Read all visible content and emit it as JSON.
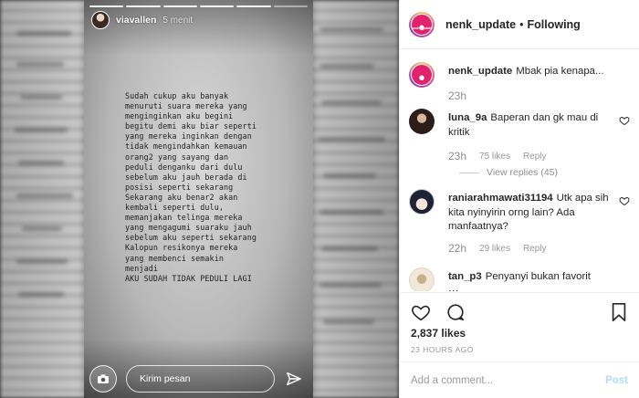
{
  "story": {
    "username": "viavallen",
    "time": "5 menit",
    "text_lines": [
      "Sudah cukup aku banyak",
      "menuruti suara mereka yang",
      "menginginkan aku begini",
      "begitu demi aku biar seperti",
      "yang mereka inginkan dengan",
      "tidak mengindahkan kemauan",
      "orang2 yang sayang dan",
      "peduli denganku dari dulu",
      "sebelum aku jauh berada di",
      "posisi seperti sekarang",
      "Sekarang aku benar2 akan",
      "kembali seperti dulu,",
      "memanjakan telinga mereka",
      "yang mengagumi suaraku jauh",
      "sebelum aku seperti sekarang",
      "Kalopun resikonya mereka",
      "yang membenci semakin",
      "menjadi",
      "AKU SUDAH TIDAK PEDULI LAGI"
    ],
    "message_placeholder": "Kirim pesan",
    "icons": {
      "camera": "camera-icon",
      "send": "send-icon"
    }
  },
  "header": {
    "username": "nenk_update",
    "dot": "•",
    "follow_status": "Following",
    "avatar_caption": "nenk_update"
  },
  "comments": [
    {
      "username": "nenk_update",
      "text": "Mbak pia kenapa...",
      "time": "23h"
    },
    {
      "username": "luna_9a",
      "text": "Baperan dan gk mau di kritik",
      "time": "23h",
      "likes": "75 likes",
      "reply": "Reply",
      "view_replies": "View replies (45)"
    },
    {
      "username": "raniarahmawati31194",
      "text": "Utk apa sih kita nyinyirin orng lain? Ada manfaatnya?",
      "time": "22h",
      "likes": "29 likes",
      "reply": "Reply"
    },
    {
      "username": "tan_p3",
      "text": "Penyanyi bukan favorit",
      "tail": "⋯"
    }
  ],
  "actions": {
    "likes": "2,837 likes",
    "posted": "23 HOURS AGO",
    "icons": [
      "heart-icon",
      "comment-icon",
      "bookmark-icon"
    ]
  },
  "add_comment": {
    "placeholder": "Add a comment...",
    "post_label": "Post"
  },
  "colors": {
    "link_disabled": "#b3dbff",
    "meta_gray": "#999999",
    "text": "#262626"
  }
}
